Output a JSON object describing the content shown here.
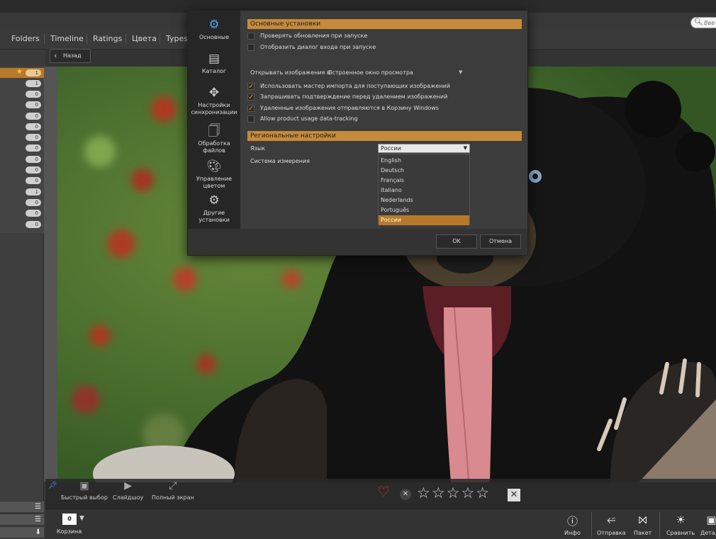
{
  "nav": {
    "tabs": [
      "Folders",
      "Timeline",
      "Ratings",
      "Цвета",
      "Types"
    ],
    "search_placeholder": "Вве",
    "back_label": "Назад"
  },
  "left_panel": {
    "counts": [
      "1",
      "1",
      "0",
      "0",
      "0",
      "0",
      "0",
      "0",
      "0",
      "0",
      "0",
      "1",
      "0",
      "0",
      "0"
    ],
    "selected_index": 0
  },
  "dialog": {
    "sidebar": [
      {
        "label": "Основные",
        "icon": "gear-icon"
      },
      {
        "label": "Каталог",
        "icon": "catalog-icon"
      },
      {
        "label": "Настройки синхронизации",
        "icon": "sync-icon"
      },
      {
        "label": "Обработка файлов",
        "icon": "files-icon"
      },
      {
        "label": "Управление цветом",
        "icon": "color-icon"
      },
      {
        "label": "Другие установки",
        "icon": "gears-icon"
      }
    ],
    "section_general": "Основные установки",
    "opt_check_updates": "Проверять обновления при запуске",
    "opt_login_dialog": "Отобразить диалог входа при запуске",
    "open_images_label": "Открывать изображения в",
    "open_images_value": "Встроенное окно просмотра",
    "opt_import_wizard": "Использовать мастер импорта для поступающих изображений",
    "opt_confirm_delete": "Запрашивать подтверждение перед удалением изображений",
    "opt_recycle_bin": "Удаленные изображения отправляются в Корзину Windows",
    "opt_tracking": "Allow product usage data-tracking",
    "section_regional": "Региональные настройки",
    "language_label": "Язык",
    "language_value": "России",
    "measure_label": "Система измерения",
    "languages": [
      "English",
      "Deutsch",
      "Français",
      "Italiano",
      "Nederlands",
      "Português",
      "России"
    ],
    "ok_label": "OK",
    "cancel_label": "Отмена"
  },
  "strip": {
    "quick_pick": "Быстрый выбор",
    "slideshow": "Слайдшоу",
    "fullscreen": "Полный экран",
    "rating_stars": 0
  },
  "bottombar": {
    "basket_count": "0",
    "basket_label": "Корзина",
    "info": "Инфо",
    "send": "Отправка",
    "batch": "Пакет",
    "compare": "Сравнить",
    "details": "Детали"
  },
  "colors": {
    "accent": "#c58a3a",
    "selection": "#b8792a"
  }
}
